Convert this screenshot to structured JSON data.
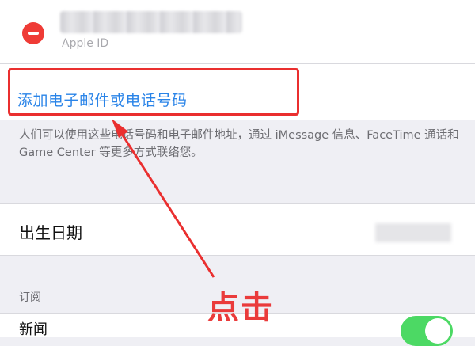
{
  "account": {
    "email_obscured": "",
    "sub_label": "Apple ID"
  },
  "add_contact": {
    "label": "添加电子邮件或电话号码"
  },
  "description": "人们可以使用这些电话号码和电子邮件地址，通过 iMessage 信息、FaceTime 通话和 Game Center 等更多方式联络您。",
  "birthday": {
    "label": "出生日期",
    "value_obscured": ""
  },
  "subscriptions": {
    "header": "订阅",
    "item_label": "新闻",
    "toggle_on": true
  },
  "annotation": {
    "text": "点击",
    "color": "#ea3b3b"
  },
  "colors": {
    "link": "#2a84e8",
    "delete": "#ef3b36",
    "toggle_on": "#4cd964",
    "highlight": "#ea2f2f"
  }
}
